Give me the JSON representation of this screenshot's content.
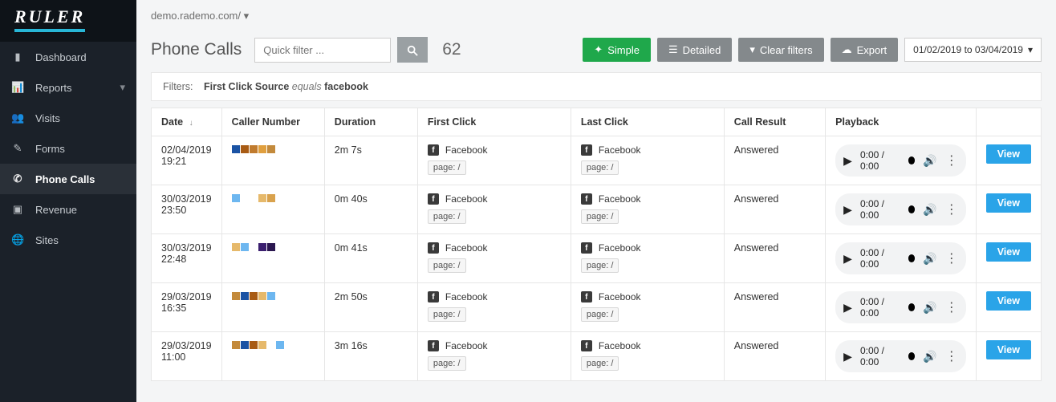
{
  "brand": "RULER",
  "breadcrumb": {
    "host": "demo.rademo.com/",
    "dropdown_icon": "▾"
  },
  "sidebar": {
    "items": [
      {
        "icon": "tachometer",
        "label": "Dashboard"
      },
      {
        "icon": "chart",
        "label": "Reports",
        "expandable": true
      },
      {
        "icon": "users",
        "label": "Visits"
      },
      {
        "icon": "pencil",
        "label": "Forms"
      },
      {
        "icon": "phone",
        "label": "Phone Calls",
        "active": true
      },
      {
        "icon": "video",
        "label": "Revenue"
      },
      {
        "icon": "globe",
        "label": "Sites"
      }
    ]
  },
  "toolbar": {
    "page_title": "Phone Calls",
    "quick_filter_placeholder": "Quick filter ...",
    "result_count": "62",
    "simple_label": "Simple",
    "detailed_label": "Detailed",
    "clear_label": "Clear filters",
    "export_label": "Export",
    "date_range": "01/02/2019 to 03/04/2019"
  },
  "filters": {
    "label": "Filters:",
    "field": "First Click Source",
    "op": "equals",
    "value": "facebook"
  },
  "table": {
    "headers": {
      "date": "Date",
      "caller": "Caller Number",
      "duration": "Duration",
      "first": "First Click",
      "last": "Last Click",
      "result": "Call Result",
      "playback": "Playback"
    },
    "click_source_label": "Facebook",
    "page_prefix": "page:",
    "view_label": "View",
    "audio_time": "0:00 / 0:00",
    "rows": [
      {
        "date": "02/04/2019",
        "time": "19:21",
        "duration": "2m 7s",
        "result": "Answered",
        "colors": [
          "#1b53a4",
          "#a85b14",
          "#c07b2e",
          "#e09f3e",
          "#c38a3c"
        ],
        "first_page": "/",
        "last_page": "/"
      },
      {
        "date": "30/03/2019",
        "time": "23:50",
        "duration": "0m 40s",
        "result": "Answered",
        "colors": [
          "#6db7f0",
          "",
          "",
          "#e6b96b",
          "#d9a24d"
        ],
        "first_page": "/",
        "last_page": "/"
      },
      {
        "date": "30/03/2019",
        "time": "22:48",
        "duration": "0m 41s",
        "result": "Answered",
        "colors": [
          "#e6b96b",
          "#6db7f0",
          "",
          "#3b1f6f",
          "#2b1750"
        ],
        "first_page": "/",
        "last_page": "/"
      },
      {
        "date": "29/03/2019",
        "time": "16:35",
        "duration": "2m 50s",
        "result": "Answered",
        "colors": [
          "#c38a3c",
          "#1b53a4",
          "#a85b14",
          "#e6b96b",
          "#6db7f0"
        ],
        "first_page": "/",
        "last_page": "/"
      },
      {
        "date": "29/03/2019",
        "time": "11:00",
        "duration": "3m 16s",
        "result": "Answered",
        "colors": [
          "#c38a3c",
          "#1b53a4",
          "#a85b14",
          "#e6b96b",
          "",
          "#6db7f0"
        ],
        "first_page": "/",
        "last_page": "/"
      }
    ]
  }
}
